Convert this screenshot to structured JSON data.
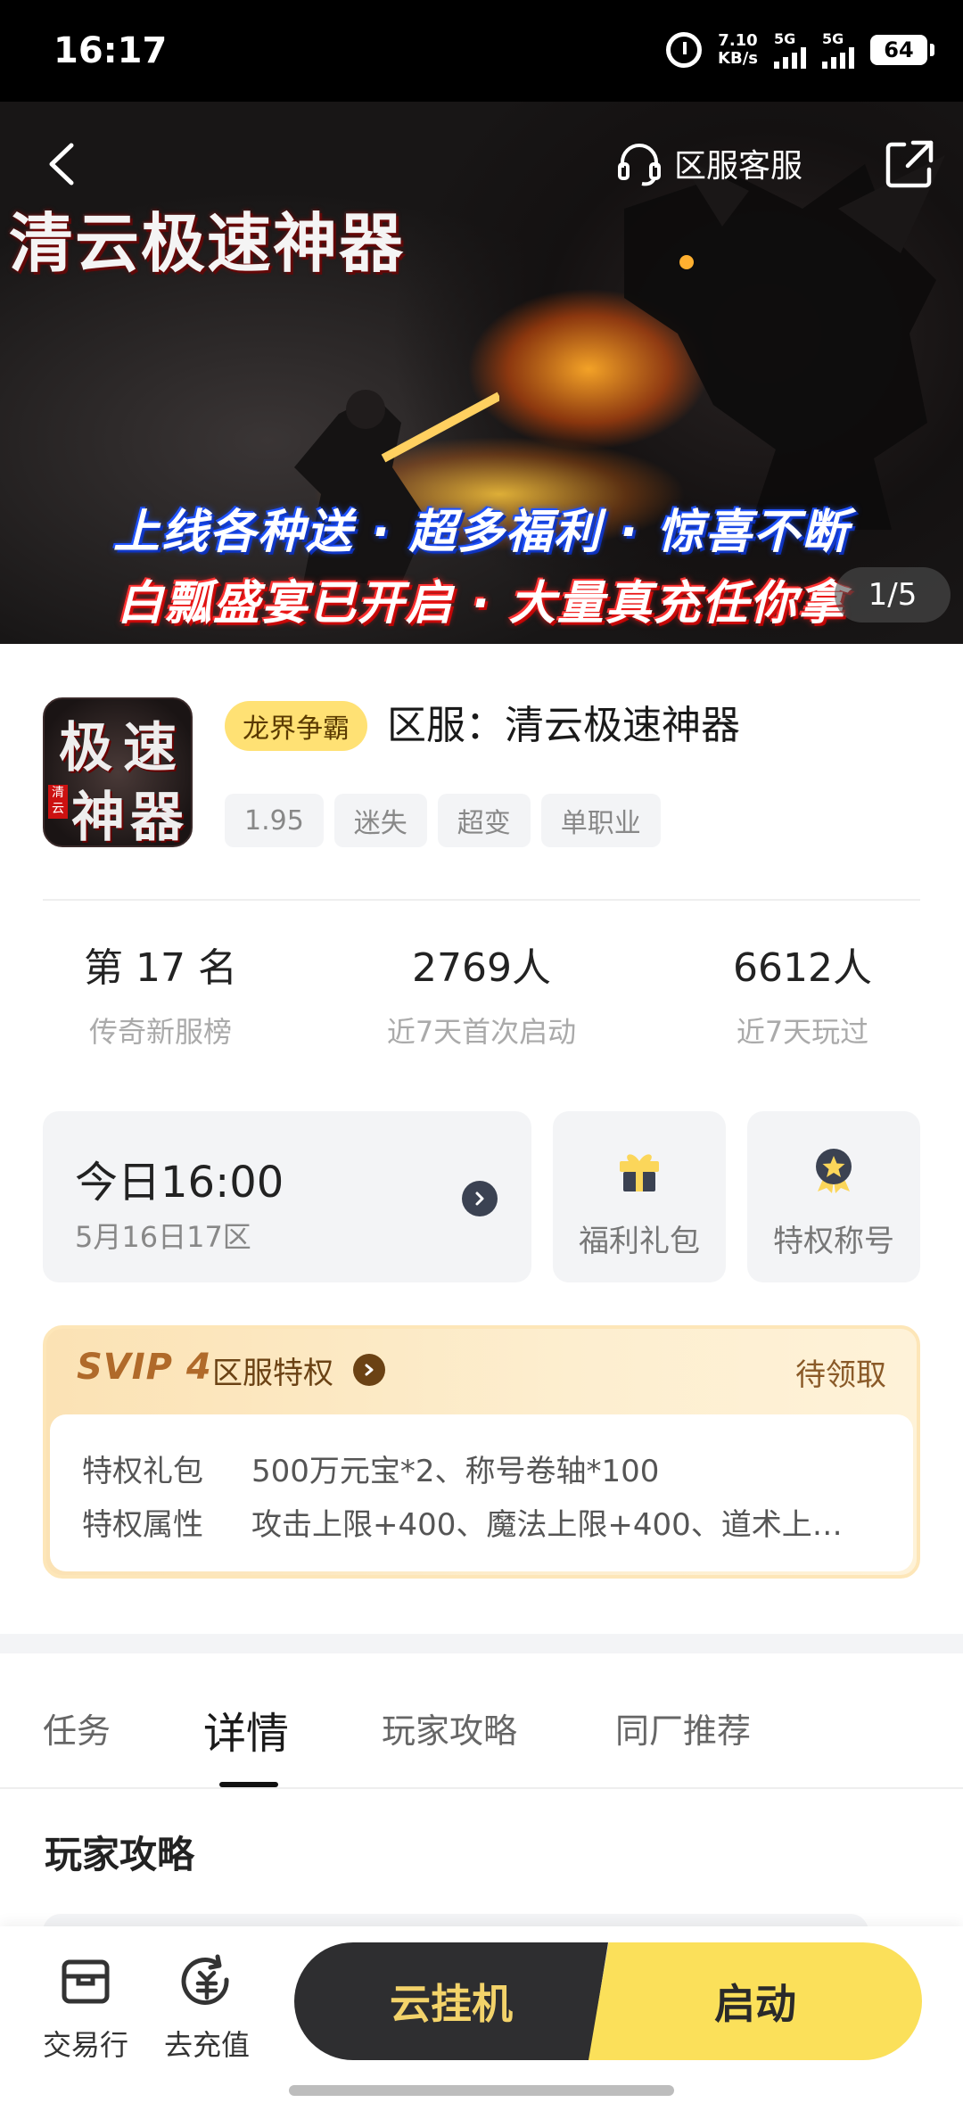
{
  "status_bar": {
    "time": "16:17",
    "net_speed_value": "7.10",
    "net_speed_unit": "KB/s",
    "signal1": "5G",
    "signal2": "5G",
    "battery": "64"
  },
  "banner": {
    "game_logo_text": "清云极速神器",
    "service_label": "区服客服",
    "slogan_line1": "上线各种送 · 超多福利 · 惊喜不断",
    "slogan_line2": "白瓢盛宴已开启 · 大量真充任你拿",
    "pager": "1/5"
  },
  "game": {
    "icon_text": [
      "极",
      "速",
      "神",
      "器"
    ],
    "icon_seal": "清云",
    "tag": "龙界争霸",
    "title": "区服：清云极速神器",
    "chips": [
      "1.95",
      "迷失",
      "超变",
      "单职业"
    ]
  },
  "stats": [
    {
      "value": "第 17 名",
      "label": "传奇新服榜"
    },
    {
      "value": "2769人",
      "label": "近7天首次启动"
    },
    {
      "value": "6612人",
      "label": "近7天玩过"
    }
  ],
  "server_open": {
    "time": "今日16:00",
    "sub": "5月16日17区"
  },
  "quick_cards": {
    "gift_label": "福利礼包",
    "title_label": "特权称号"
  },
  "svip": {
    "badge": "SVIP 4",
    "label": "区服特权",
    "claim": "待领取",
    "rows": [
      {
        "key": "特权礼包",
        "value": "500万元宝*2、称号卷轴*100"
      },
      {
        "key": "特权属性",
        "value": "攻击上限+400、魔法上限+400、道术上…"
      }
    ]
  },
  "tabs": {
    "items": [
      "任务",
      "详情",
      "玩家攻略",
      "同厂推荐"
    ],
    "active": "详情"
  },
  "section": {
    "title": "玩家攻略"
  },
  "bottom_bar": {
    "trade": "交易行",
    "recharge": "去充值",
    "cloud": "云挂机",
    "start": "启动"
  },
  "colors": {
    "accent_yellow": "#fbe05a",
    "dark_button": "#2e2e30",
    "svip_brown": "#b06a2a"
  }
}
